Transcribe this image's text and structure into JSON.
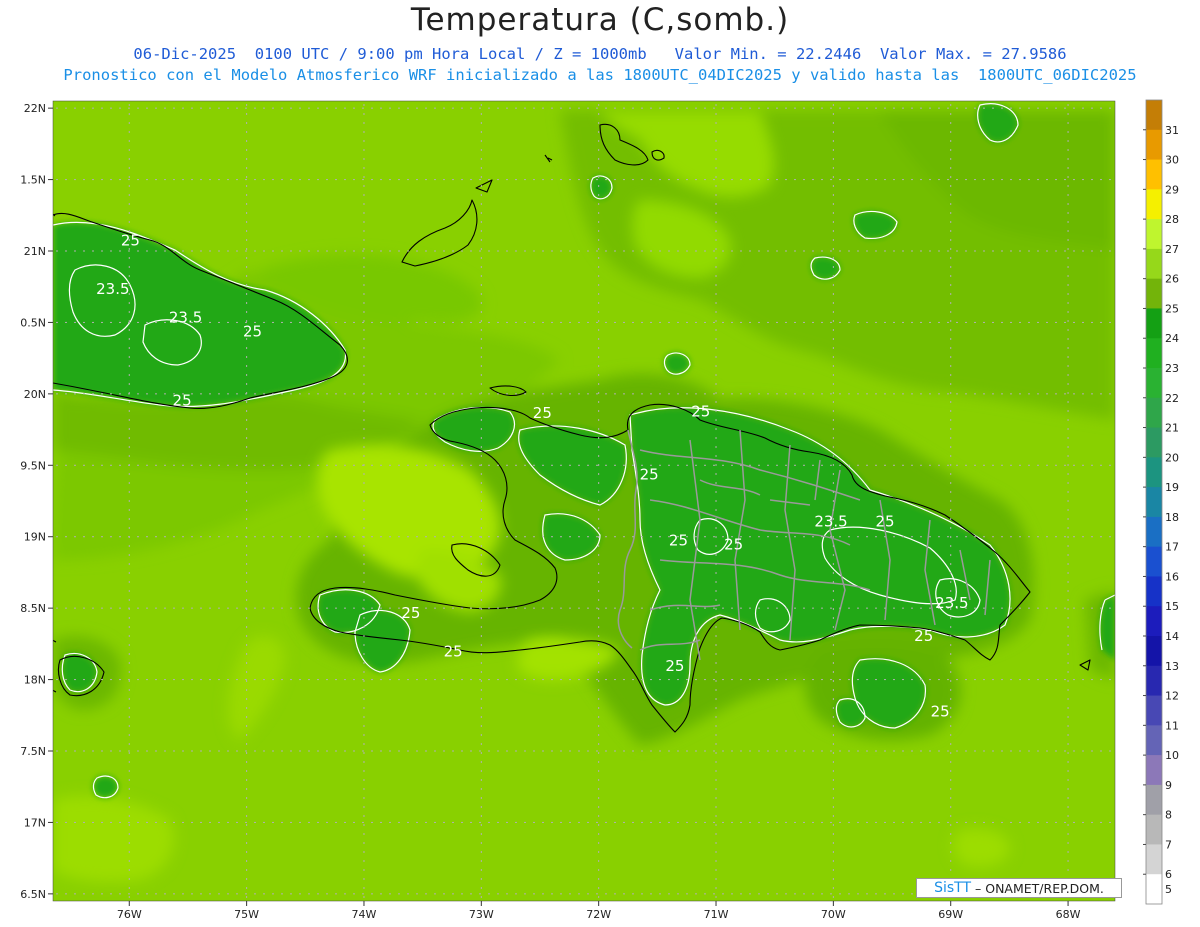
{
  "header": {
    "title": "Temperatura (C,somb.)",
    "subtitle_line1": "06-Dic-2025  0100 UTC / 9:00 pm Hora Local / Z = 1000mb   Valor Min. = 22.2446  Valor Max. = 27.9586",
    "subtitle_line2": "Pronostico con el Modelo Atmosferico WRF inicializado a las 1800UTC_04DIC2025 y valido hasta las  1800UTC_06DIC2025"
  },
  "axes": {
    "lat_ticks": [
      "22N",
      "21.5N",
      "21N",
      "20.5N",
      "20N",
      "19.5N",
      "19N",
      "18.5N",
      "18N",
      "17.5N",
      "17N",
      "16.5N"
    ],
    "lat_tick_labels": [
      "22N",
      "1.5N",
      "21N",
      "0.5N",
      "20N",
      "9.5N",
      "19N",
      "8.5N",
      "18N",
      "7.5N",
      "17N",
      "6.5N"
    ],
    "lon_ticks": [
      "76W",
      "75W",
      "74W",
      "73W",
      "72W",
      "71W",
      "70W",
      "69W",
      "68W"
    ],
    "lat_range": [
      16.45,
      22.05
    ],
    "lon_range": [
      -76.65,
      -67.6
    ]
  },
  "colorbar": {
    "labels": [
      "31",
      "30",
      "29",
      "28",
      "27",
      "26",
      "25",
      "24",
      "23",
      "22",
      "21",
      "20",
      "19",
      "18",
      "17",
      "16",
      "15",
      "14",
      "13",
      "12",
      "11",
      "10",
      "9",
      "8",
      "7",
      "6",
      "5"
    ],
    "colors": [
      "#c47e06",
      "#e89a00",
      "#ffc000",
      "#f5f000",
      "#bff52e",
      "#96d81a",
      "#73b40a",
      "#14a014",
      "#20b020",
      "#2ab232",
      "#2fa64a",
      "#2c9a62",
      "#1c9480",
      "#1a86a4",
      "#1a6fc4",
      "#1a50d0",
      "#1632c8",
      "#1c1cbc",
      "#1414a8",
      "#2828b0",
      "#4848b4",
      "#6464b6",
      "#8c78b8",
      "#a0a0a8",
      "#b8b8b8",
      "#d4d4d4",
      "#ffffff"
    ]
  },
  "contour_labels": [
    {
      "text": "25",
      "lon": -75.99,
      "lat": 21.04
    },
    {
      "text": "23.5",
      "lon": -76.14,
      "lat": 20.7
    },
    {
      "text": "23.5",
      "lon": -75.52,
      "lat": 20.5
    },
    {
      "text": "25",
      "lon": -74.95,
      "lat": 20.4
    },
    {
      "text": "25",
      "lon": -75.55,
      "lat": 19.92
    },
    {
      "text": "25",
      "lon": -72.48,
      "lat": 19.83
    },
    {
      "text": "25",
      "lon": -71.13,
      "lat": 19.84
    },
    {
      "text": "25",
      "lon": -71.57,
      "lat": 19.4
    },
    {
      "text": "23.5",
      "lon": -70.02,
      "lat": 19.07
    },
    {
      "text": "25",
      "lon": -69.56,
      "lat": 19.07
    },
    {
      "text": "25",
      "lon": -71.32,
      "lat": 18.94
    },
    {
      "text": "25",
      "lon": -70.85,
      "lat": 18.91
    },
    {
      "text": "23.5",
      "lon": -68.99,
      "lat": 18.5
    },
    {
      "text": "25",
      "lon": -73.6,
      "lat": 18.43
    },
    {
      "text": "25",
      "lon": -69.23,
      "lat": 18.27
    },
    {
      "text": "25",
      "lon": -73.24,
      "lat": 18.16
    },
    {
      "text": "25",
      "lon": -71.35,
      "lat": 18.06
    },
    {
      "text": "25",
      "lon": -69.09,
      "lat": 17.74
    }
  ],
  "credit": {
    "brand": "SisTT",
    "text": " – ONAMET/REP.DOM."
  }
}
